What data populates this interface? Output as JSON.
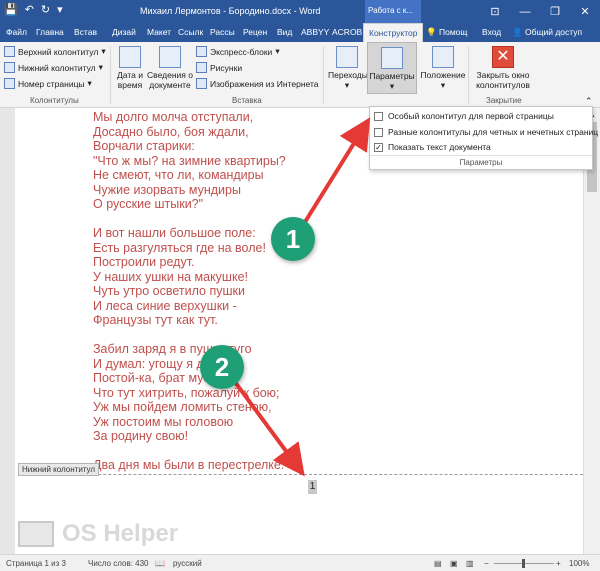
{
  "window": {
    "title": "Михаил Лермонтов - Бородино.docx - Word",
    "context_tab": "Работа с к...",
    "controls": [
      "—",
      "❐",
      "✕"
    ]
  },
  "tabs": [
    {
      "label": "Файл"
    },
    {
      "label": "Главна"
    },
    {
      "label": "Встав"
    },
    {
      "label": "Дизай"
    },
    {
      "label": "Макет"
    },
    {
      "label": "Ссылк"
    },
    {
      "label": "Рассы"
    },
    {
      "label": "Рецен"
    },
    {
      "label": "Вид"
    },
    {
      "label": "ABBYY"
    },
    {
      "label": "ACROB"
    },
    {
      "label": "Конструктор"
    }
  ],
  "tell_me": "Помощ",
  "sign_in": "Вход",
  "share": "Общий доступ",
  "ribbon": {
    "headers_group": {
      "label": "Колонтитулы",
      "items": [
        "Верхний колонтитул",
        "Нижний колонтитул",
        "Номер страницы"
      ]
    },
    "insert_group": {
      "label": "Вставка",
      "date_time": "Дата и время",
      "doc_info": "Сведения о документе",
      "items": [
        "Экспресс-блоки",
        "Рисунки",
        "Изображения из Интернета"
      ]
    },
    "nav": {
      "transitions": "Переходы",
      "params": "Параметры",
      "position": "Положение"
    },
    "close_group": {
      "label": "Закрытие",
      "close": "Закрыть окно колонтитулов"
    }
  },
  "dropdown": {
    "items": [
      {
        "label": "Особый колонтитул для первой страницы",
        "checked": false
      },
      {
        "label": "Разные колонтитулы для четных и нечетных страниц",
        "checked": false
      },
      {
        "label": "Показать текст документа",
        "checked": true
      }
    ],
    "footer": "Параметры"
  },
  "document": {
    "poem_lines": [
      "Мы долго молча отступали,",
      "Досадно было, боя ждали,",
      "Ворчали старики:",
      "\"Что ж мы? на зимние квартиры?",
      "Не смеют, что ли, командиры",
      "Чужие изорвать мундиры",
      "О русские штыки?\"",
      "",
      "И вот нашли большое поле:",
      "Есть разгуляться где на воле!",
      "Построили редут.",
      "У наших ушки на макушке!",
      "Чуть утро осветило пушки",
      "И леса синие верхушки -",
      "Французы тут как тут.",
      "",
      "Забил заряд я в пушку туго",
      "И думал: угощу я друга!",
      "Постой-ка, брат мусью!",
      "Что тут хитрить, пожалуй к бою;",
      "Уж мы пойдем ломить стеною,",
      "Уж постоим мы головою",
      "За родину свою!",
      "",
      "Два дня мы были в перестрелке."
    ],
    "footer_label": "Нижний колонтитул",
    "page_number": "1"
  },
  "markers": [
    "1",
    "2"
  ],
  "status": {
    "page": "Страница 1 из 3",
    "words": "Число слов: 430",
    "lang": "русский",
    "zoom": "100%"
  },
  "watermark": "OS Helper",
  "colors": {
    "brand": "#2b579a",
    "poem": "#c0504d",
    "marker": "#1e9f76",
    "arrow": "#e53935"
  }
}
